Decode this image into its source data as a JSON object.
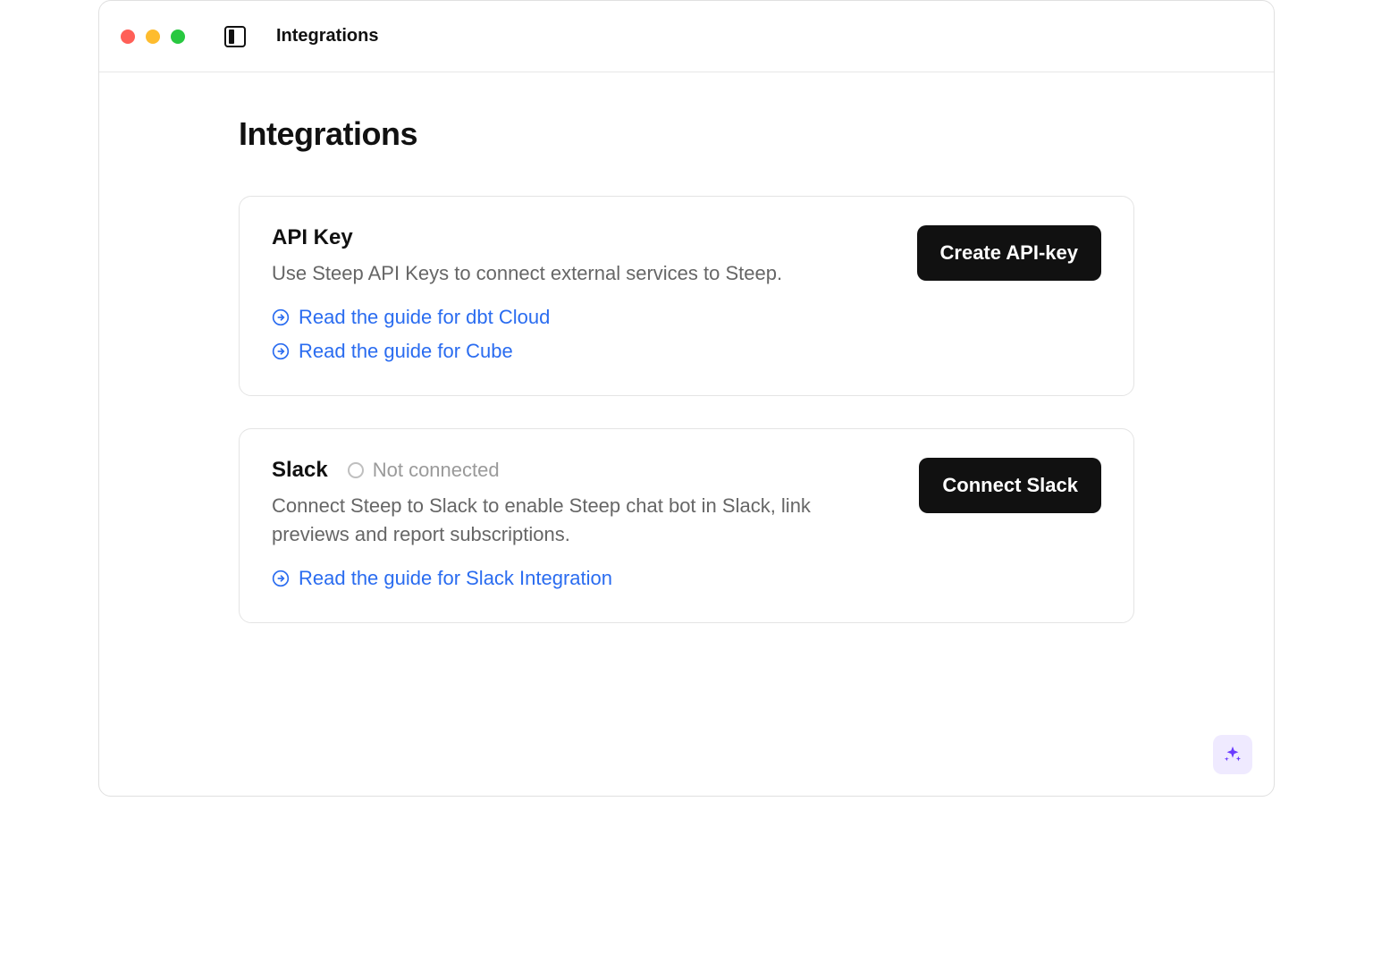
{
  "window": {
    "title": "Integrations"
  },
  "page": {
    "title": "Integrations"
  },
  "cards": {
    "api_key": {
      "title": "API Key",
      "description": "Use Steep API Keys to connect external services to Steep.",
      "button_label": "Create API-key",
      "links": {
        "dbt": "Read the guide for dbt Cloud",
        "cube": "Read the guide for Cube"
      }
    },
    "slack": {
      "title": "Slack",
      "status_label": "Not connected",
      "description": "Connect Steep to Slack to enable Steep chat bot in Slack, link previews and report subscriptions.",
      "button_label": "Connect Slack",
      "links": {
        "slack_guide": "Read the guide for Slack Integration"
      }
    }
  }
}
